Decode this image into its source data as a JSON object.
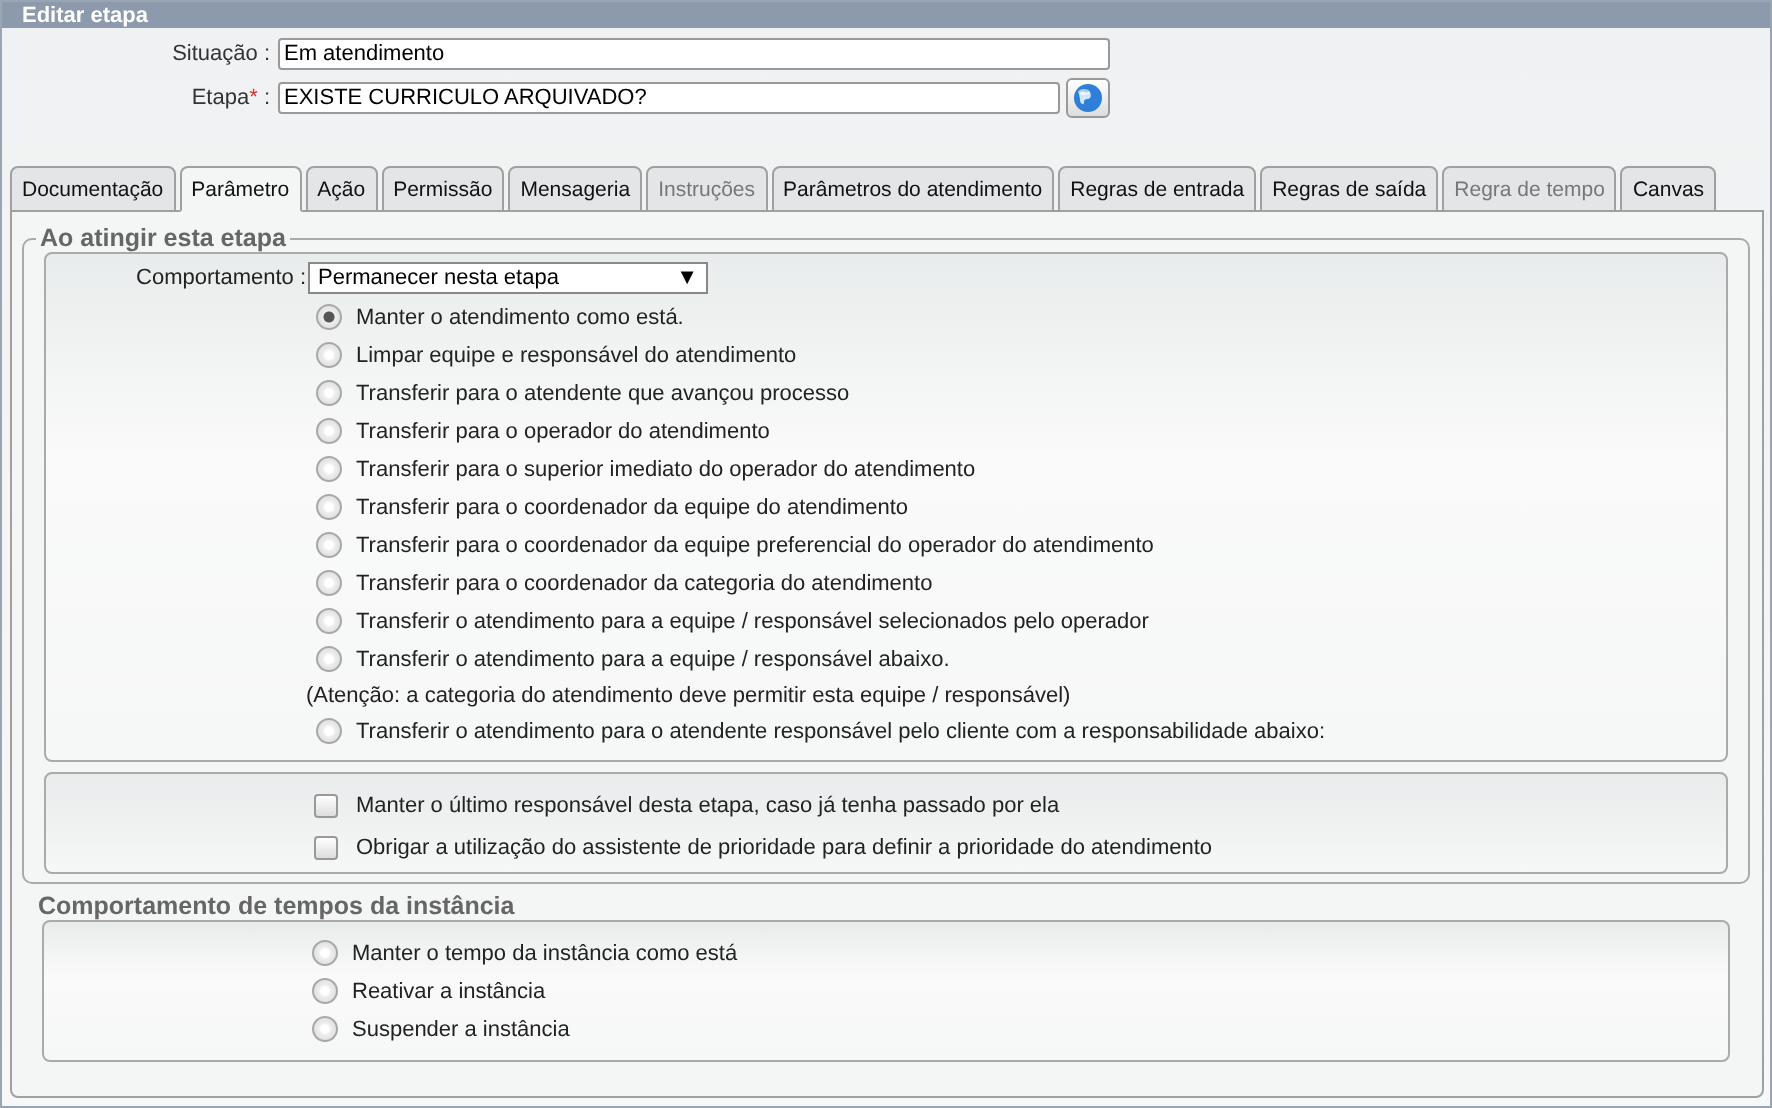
{
  "window": {
    "title": "Editar etapa"
  },
  "fields": [
    {
      "label": "Situação",
      "required": false,
      "value": "Em atendimento",
      "globe_button": false
    },
    {
      "label": "Etapa",
      "required": true,
      "value": "EXISTE CURRICULO ARQUIVADO?",
      "globe_button": true
    }
  ],
  "required_mark": "*",
  "label_separator": ":",
  "tabs": [
    {
      "label": "Documentação",
      "selected": false,
      "disabled": false
    },
    {
      "label": "Parâmetro",
      "selected": true,
      "disabled": false
    },
    {
      "label": "Ação",
      "selected": false,
      "disabled": false
    },
    {
      "label": "Permissão",
      "selected": false,
      "disabled": false
    },
    {
      "label": "Mensageria",
      "selected": false,
      "disabled": false
    },
    {
      "label": "Instruções",
      "selected": false,
      "disabled": true
    },
    {
      "label": "Parâmetros do atendimento",
      "selected": false,
      "disabled": false
    },
    {
      "label": "Regras de entrada",
      "selected": false,
      "disabled": false
    },
    {
      "label": "Regras de saída",
      "selected": false,
      "disabled": false
    },
    {
      "label": "Regra de tempo",
      "selected": false,
      "disabled": true
    },
    {
      "label": "Canvas",
      "selected": false,
      "disabled": false
    }
  ],
  "stage_section": {
    "legend": "Ao atingir esta etapa",
    "behavior": {
      "label": "Comportamento :",
      "value": "Permanecer nesta etapa",
      "arrow": "▼"
    },
    "options": [
      {
        "kind": "radio",
        "label": "Manter o atendimento como está.",
        "selected": true
      },
      {
        "kind": "radio",
        "label": "Limpar equipe e responsável do atendimento",
        "selected": false
      },
      {
        "kind": "radio",
        "label": "Transferir para o atendente que avançou processo",
        "selected": false
      },
      {
        "kind": "radio",
        "label": "Transferir para o operador do atendimento",
        "selected": false
      },
      {
        "kind": "radio",
        "label": "Transferir para o superior imediato do operador do atendimento",
        "selected": false
      },
      {
        "kind": "radio",
        "label": "Transferir para o coordenador da equipe do atendimento",
        "selected": false
      },
      {
        "kind": "radio",
        "label": "Transferir para o coordenador da equipe preferencial do operador do atendimento",
        "selected": false
      },
      {
        "kind": "radio",
        "label": "Transferir para o coordenador da categoria do atendimento",
        "selected": false
      },
      {
        "kind": "radio",
        "label": "Transferir o atendimento para a equipe / responsável selecionados pelo operador",
        "selected": false
      },
      {
        "kind": "radio",
        "label": "Transferir o atendimento para a equipe / responsável abaixo.",
        "selected": false
      },
      {
        "kind": "note",
        "label": "(Atenção: a categoria do atendimento deve permitir esta equipe / responsável)"
      },
      {
        "kind": "radio",
        "label": "Transferir o atendimento para o atendente responsável pelo cliente com a responsabilidade abaixo:",
        "selected": false
      }
    ],
    "checkboxes": [
      {
        "label": "Manter o último responsável desta etapa, caso já tenha passado por ela",
        "checked": false
      },
      {
        "label": "Obrigar a utilização do assistente de prioridade para definir a prioridade do atendimento",
        "checked": false
      }
    ]
  },
  "time_section": {
    "legend": "Comportamento de tempos da instância",
    "options": [
      {
        "label": "Manter o tempo da instância como está",
        "selected": false
      },
      {
        "label": "Reativar a instância",
        "selected": false
      },
      {
        "label": "Suspender a instância",
        "selected": false
      }
    ]
  }
}
